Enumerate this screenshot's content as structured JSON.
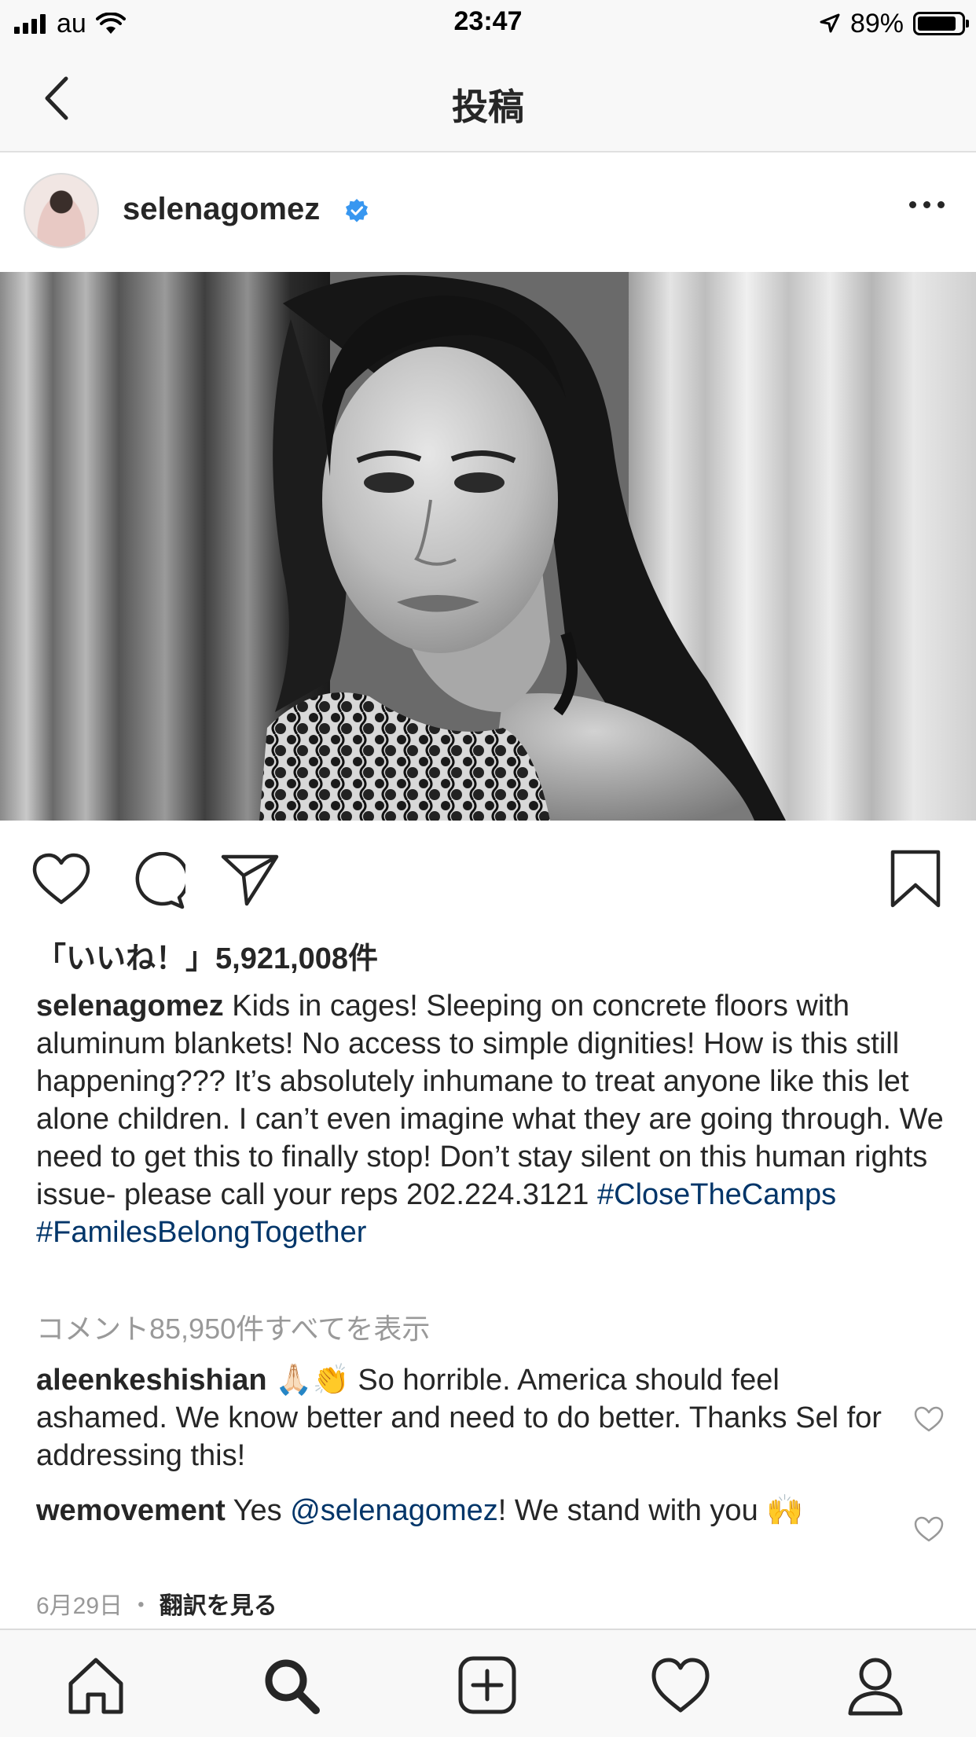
{
  "status": {
    "carrier": "au",
    "time": "23:47",
    "battery": "89%",
    "battery_level": 0.89
  },
  "nav": {
    "title": "投稿"
  },
  "post": {
    "username": "selenagomez",
    "likes": "「いいね！」5,921,008件",
    "caption": {
      "username": "selenagomez",
      "text": "Kids in cages! Sleeping on concrete floors with aluminum blankets! No access to simple dignities! How is this still happening??? It’s absolutely inhumane to treat anyone like this let alone children. I can’t even imagine what they are going through. We need to get this to finally stop! Don’t stay silent on this human rights issue- please call your reps 202.224.3121",
      "hashtags": [
        "#CloseTheCamps",
        "#FamilesBelongTogether"
      ]
    },
    "view_comments": "コメント85,950件すべてを表示",
    "comments": [
      {
        "username": "aleenkeshishian",
        "emoji": "🙏🏻👏",
        "text": "So horrible. America should feel ashamed. We know better and need to do better. Thanks Sel for addressing this!"
      },
      {
        "username": "wemovement",
        "text_before": "Yes",
        "mention": "@selenagomez",
        "text_after": "! We stand with you",
        "emoji": "🙌"
      }
    ],
    "date": "6月29日",
    "separator": "・",
    "translate": "翻訳を見る"
  },
  "colors": {
    "text": "#262626",
    "secondary": "#999999",
    "link": "#003569",
    "verified": "#3897f0"
  }
}
